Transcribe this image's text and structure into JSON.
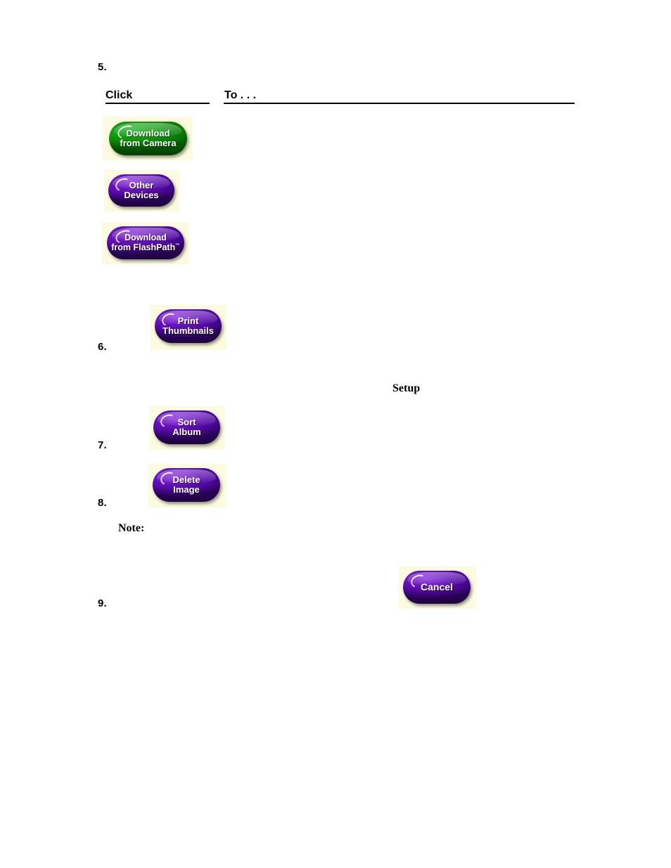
{
  "document": {
    "steps": [
      {
        "number": "5."
      },
      {
        "number": "6."
      },
      {
        "number": "7."
      },
      {
        "number": "8."
      },
      {
        "number": "9."
      }
    ],
    "table_header": {
      "col1": "Click",
      "col2": "To . . ."
    },
    "inline_terms": {
      "setup": "Setup",
      "note": "Note:"
    },
    "buttons": [
      {
        "id": "download-from-camera",
        "label": "Download\nfrom Camera",
        "color": "#0a8207",
        "tile_color": "#fcfbdf",
        "text_color": "#ffffff"
      },
      {
        "id": "other-devices",
        "label": "Other\nDevices",
        "color": "#4e089c",
        "tile_color": "#fcfbdf",
        "text_color": "#ffffff"
      },
      {
        "id": "download-from-flashpath",
        "label": "Download\nfrom FlashPath",
        "trademark": "™",
        "color": "#4e089c",
        "tile_color": "#fcfbdf",
        "text_color": "#ffffff"
      },
      {
        "id": "print-thumbnails",
        "label": "Print\nThumbnails",
        "color": "#4e089c",
        "tile_color": "#fcfbdf",
        "text_color": "#ffffff"
      },
      {
        "id": "sort-album",
        "label": "Sort\nAlbum",
        "color": "#4e089c",
        "tile_color": "#fcfbdf",
        "text_color": "#ffffff"
      },
      {
        "id": "delete-image",
        "label": "Delete\nImage",
        "color": "#4e089c",
        "tile_color": "#fcfbdf",
        "text_color": "#ffffff"
      },
      {
        "id": "cancel",
        "label": "Cancel",
        "color": "#4e089c",
        "tile_color": "#fcfbdf",
        "text_color": "#ffffff"
      }
    ]
  }
}
